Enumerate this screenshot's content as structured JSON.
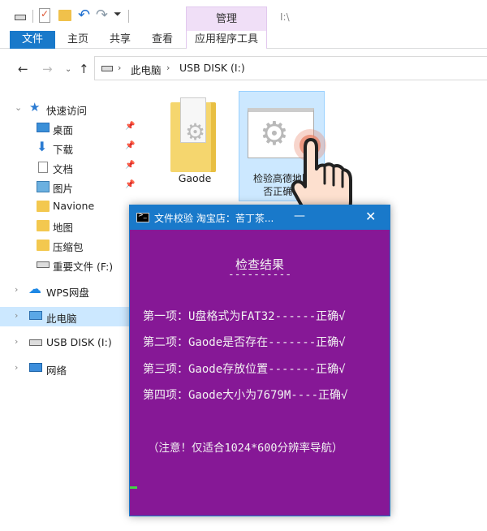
{
  "window": {
    "path_title": "I:\\",
    "contextual_tab_group": "管理"
  },
  "ribbon": {
    "tabs": [
      "文件",
      "主页",
      "共享",
      "查看",
      "应用程序工具"
    ]
  },
  "address_bar": {
    "segments": [
      "此电脑",
      "USB DISK (I:)"
    ]
  },
  "sidebar": {
    "items": [
      {
        "label": "快速访问",
        "icon": "star-icon"
      },
      {
        "label": "桌面",
        "icon": "desktop-icon",
        "pinned": true
      },
      {
        "label": "下载",
        "icon": "download-icon",
        "pinned": true
      },
      {
        "label": "文档",
        "icon": "document-icon",
        "pinned": true
      },
      {
        "label": "图片",
        "icon": "picture-icon",
        "pinned": true
      },
      {
        "label": "Navione",
        "icon": "folder-icon"
      },
      {
        "label": "地图",
        "icon": "folder-icon"
      },
      {
        "label": "压缩包",
        "icon": "folder-icon"
      },
      {
        "label": "重要文件 (F:)",
        "icon": "drive-icon"
      },
      {
        "label": "WPS网盘",
        "icon": "cloud-icon"
      },
      {
        "label": "此电脑",
        "icon": "computer-icon",
        "selected": true
      },
      {
        "label": "USB DISK (I:)",
        "icon": "drive-icon"
      },
      {
        "label": "网络",
        "icon": "network-icon"
      }
    ]
  },
  "files": [
    {
      "name": "Gaode",
      "type": "folder"
    },
    {
      "name_line1": "检验高德地图",
      "name_line2": "否正确.b",
      "type": "exe",
      "selected": true
    }
  ],
  "console": {
    "title": "文件校验 淘宝店：苦丁茶...",
    "heading": "检查结果",
    "underline": "----------",
    "lines": [
      "第一项：U盘格式为FAT32------正确√",
      "第二项：Gaode是否存在-------正确√",
      "第三项：Gaode存放位置-------正确√",
      "第四项：Gaode大小为7679M----正确√"
    ],
    "note": "（注意！仅适合1024*600分辨率导航）",
    "background_color": "#861896",
    "text_color": "#f2f2f2"
  },
  "colors": {
    "accent": "#1979ca",
    "selection": "#cce8ff",
    "manage_tab": "#f0dff7"
  }
}
